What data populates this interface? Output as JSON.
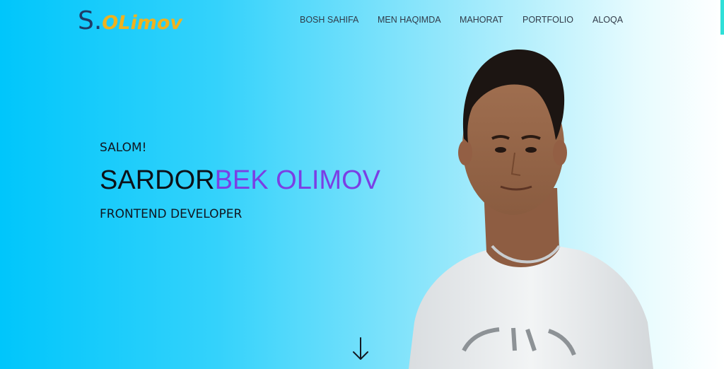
{
  "logo": {
    "initial": "S.",
    "rest": "OLimov"
  },
  "nav": {
    "items": [
      {
        "label": "BOSH SAHIFA"
      },
      {
        "label": "MEN HAQIMDA"
      },
      {
        "label": "MAHORAT"
      },
      {
        "label": "PORTFOLIO"
      },
      {
        "label": "ALOQA"
      }
    ]
  },
  "hero": {
    "greeting": "SALOM!",
    "name_first": "SARDOR",
    "name_rest": "BEK OLIMOV",
    "role": "FRONTEND DEVELOPER"
  },
  "colors": {
    "background_start": "#00c6fb",
    "background_end": "#ffffff",
    "logo_initial": "#1f3b66",
    "logo_rest": "#f0b21e",
    "name_accent": "#7b3fe4",
    "scroll_accent": "#2fe0d8"
  },
  "icons": {
    "scroll_down": "arrow-down-icon"
  }
}
